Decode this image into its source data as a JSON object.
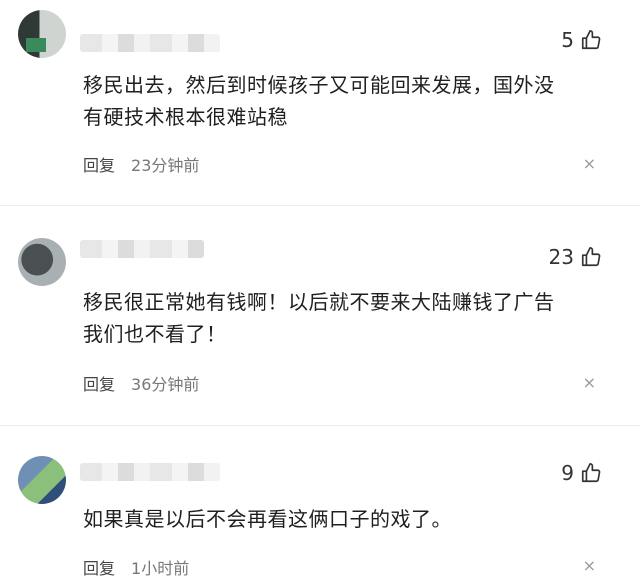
{
  "comments": [
    {
      "likes": "5",
      "text_line1": "移民出去，然后到时候孩子又可能回来发展，国外没",
      "text_line2": "有硬技术根本很难站稳",
      "reply_label": "回复",
      "time": "23分钟前"
    },
    {
      "likes": "23",
      "text_line1": "移民很正常她有钱啊！以后就不要来大陆赚钱了广告",
      "text_line2": "我们也不看了！",
      "reply_label": "回复",
      "time": "36分钟前"
    },
    {
      "likes": "9",
      "text_line1": "如果真是以后不会再看这俩口子的戏了。",
      "text_line2": "",
      "reply_label": "回复",
      "time": "1小时前"
    }
  ],
  "icons": {
    "like": "thumbs-up-icon",
    "close": "close-icon"
  },
  "close_glyph": "×"
}
